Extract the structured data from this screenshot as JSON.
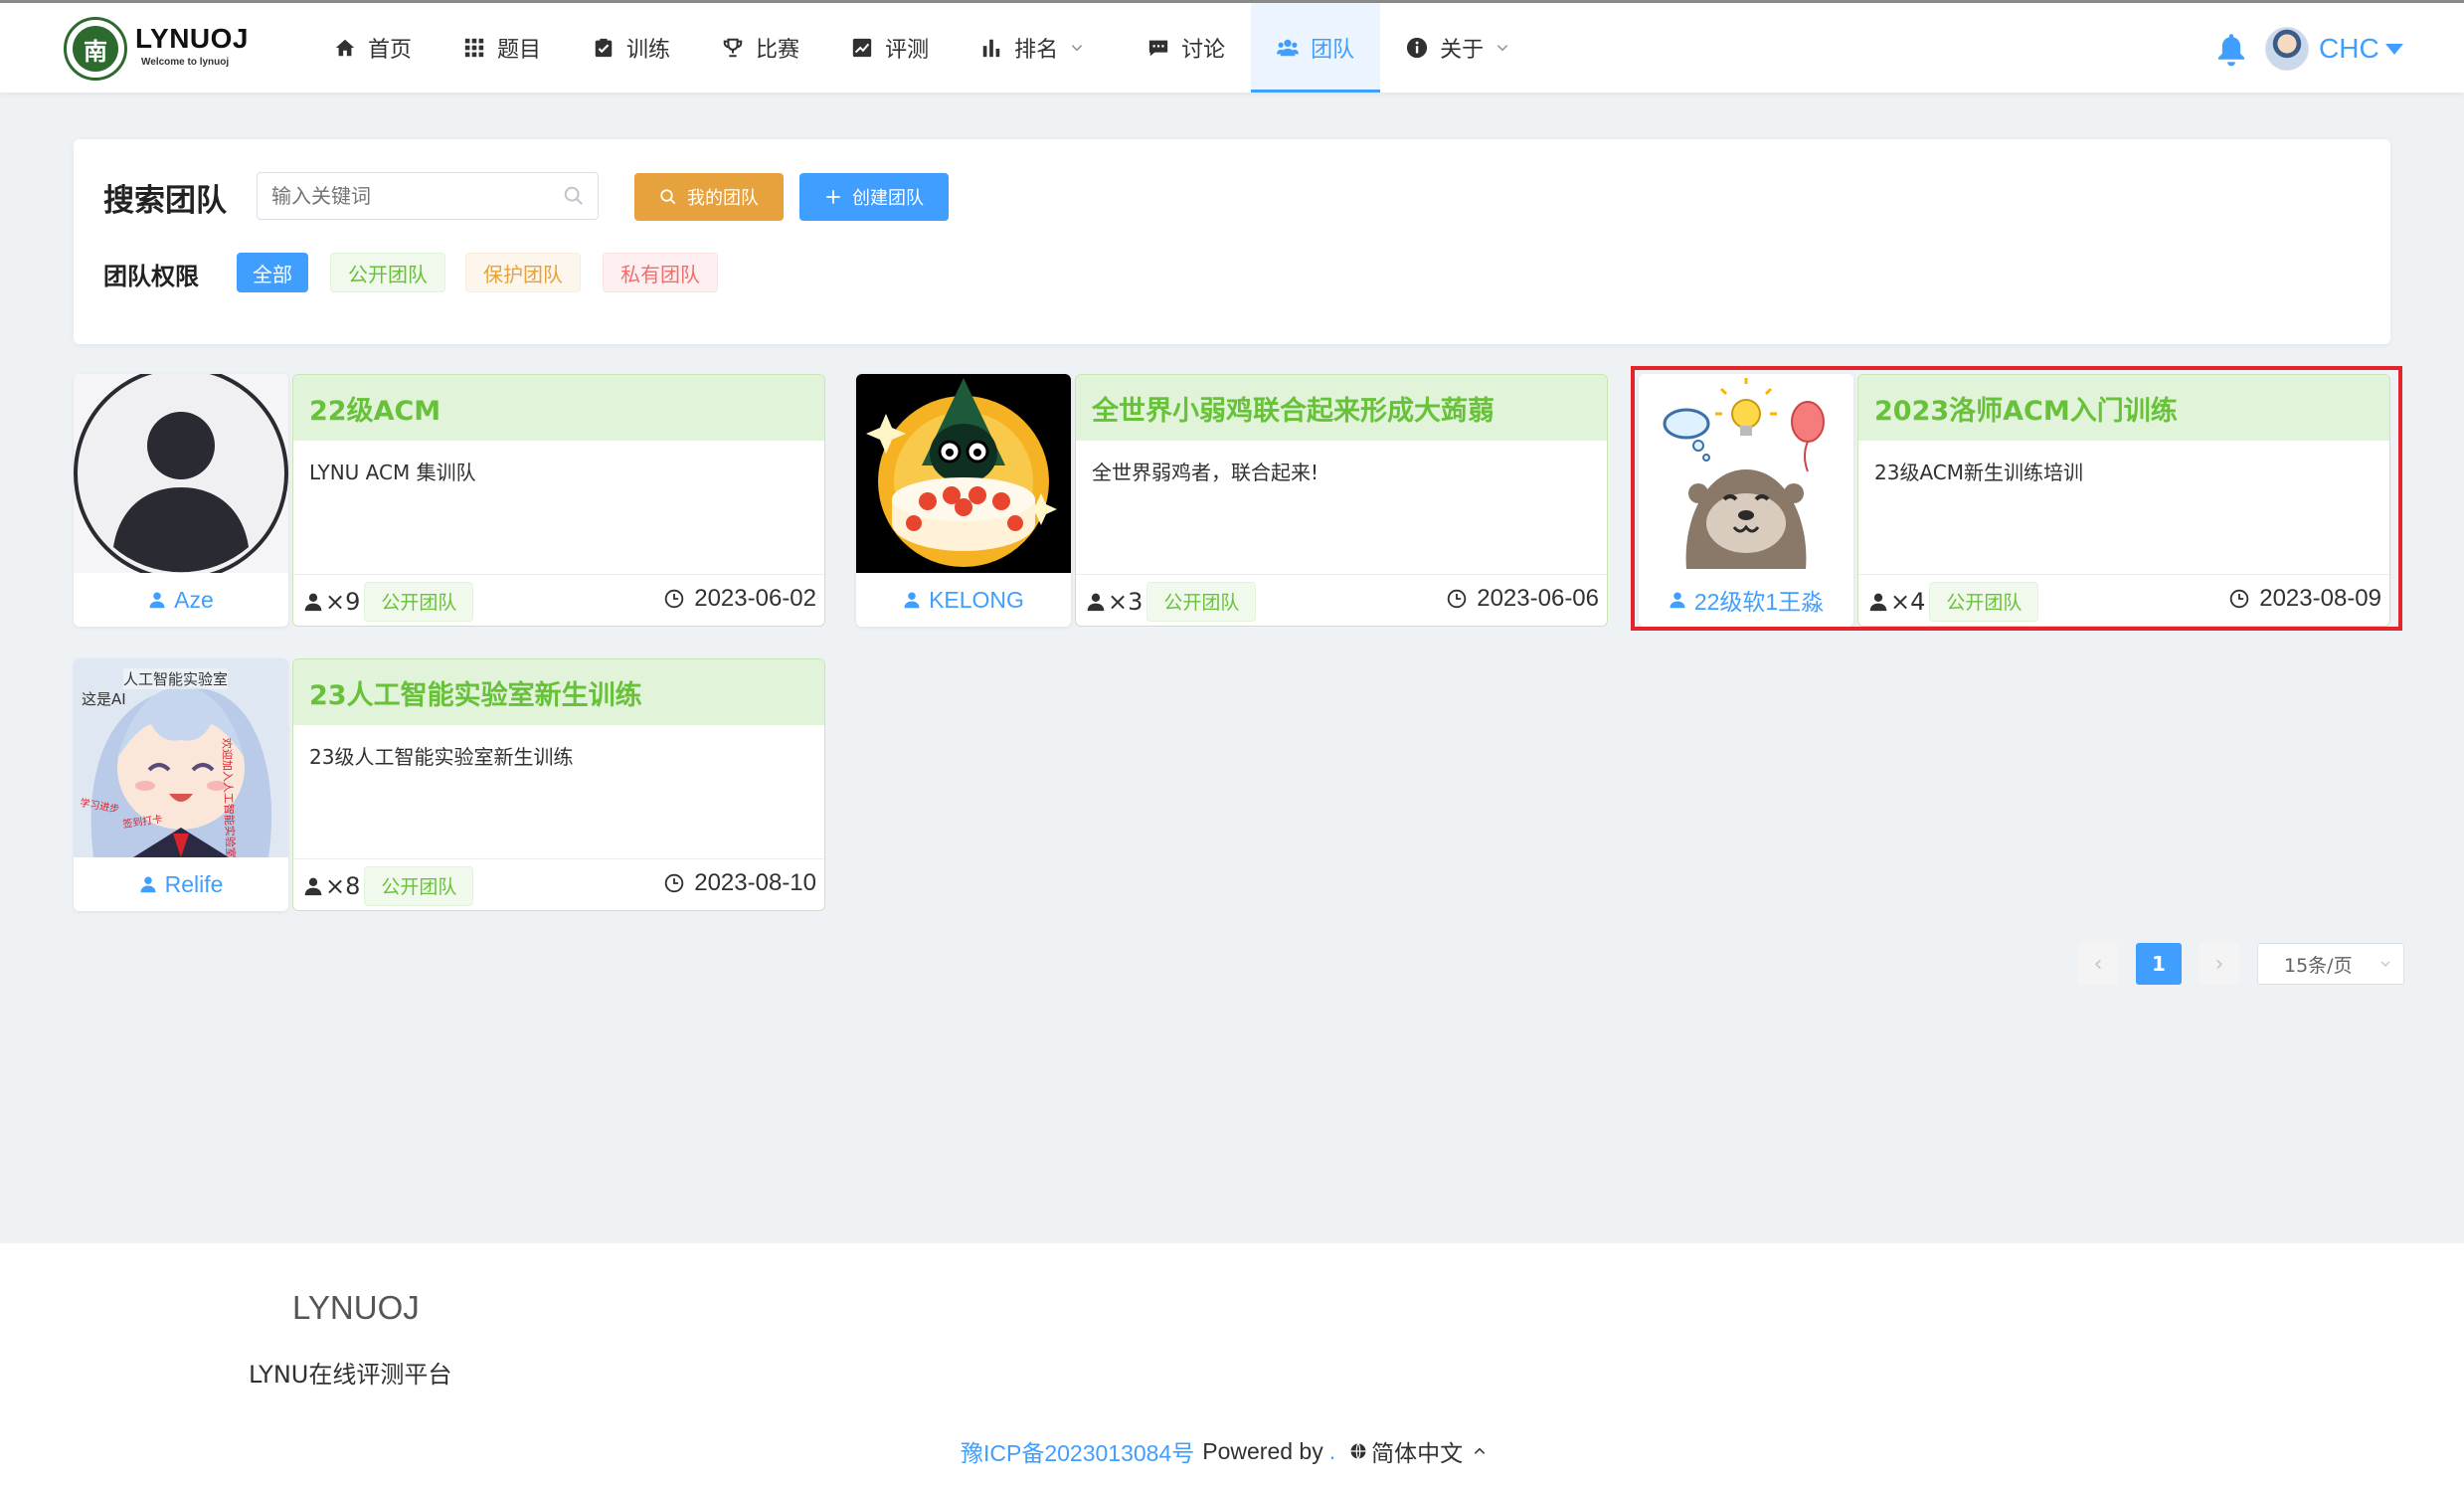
{
  "app": {
    "brand": "LYNUOJ",
    "brand_sub": "Welcome to lynuoj",
    "logo_glyph": "南",
    "accent": "#409eff",
    "success": "#67c23a",
    "warning": "#e6a23c",
    "danger": "#f56c6c"
  },
  "nav": {
    "items": [
      {
        "label": "首页",
        "icon": "home-icon"
      },
      {
        "label": "题目",
        "icon": "grid-icon"
      },
      {
        "label": "训练",
        "icon": "clipboard-check-icon"
      },
      {
        "label": "比赛",
        "icon": "trophy-icon"
      },
      {
        "label": "评测",
        "icon": "trend-chart-icon"
      },
      {
        "label": "排名",
        "icon": "bar-chart-icon",
        "dropdown": true
      },
      {
        "label": "讨论",
        "icon": "comment-icon"
      },
      {
        "label": "团队",
        "icon": "users-icon",
        "active": true
      },
      {
        "label": "关于",
        "icon": "info-icon",
        "dropdown": true
      }
    ],
    "username": "CHC"
  },
  "search": {
    "title": "搜索团队",
    "placeholder": "输入关键词",
    "my_team_label": "我的团队",
    "create_team_label": "创建团队",
    "permission_label": "团队权限",
    "filters": [
      "全部",
      "公开团队",
      "保护团队",
      "私有团队"
    ]
  },
  "teams": [
    {
      "name": "22级ACM",
      "desc": "LYNU ACM 集训队",
      "owner": "Aze",
      "members": "×9",
      "privacy": "公开团队",
      "date": "2023-06-02"
    },
    {
      "name": "全世界小弱鸡联合起来形成大蒟蒻",
      "desc": "全世界弱鸡者，联合起来!",
      "owner": "KELONG",
      "members": "×3",
      "privacy": "公开团队",
      "date": "2023-06-06"
    },
    {
      "name": "2023洛师ACM入门训练",
      "desc": "23级ACM新生训练培训",
      "owner": "22级软1王淼",
      "members": "×4",
      "privacy": "公开团队",
      "date": "2023-08-09"
    },
    {
      "name": "23人工智能实验室新生训练",
      "desc": "23级人工智能实验室新生训练",
      "owner": "Relife",
      "members": "×8",
      "privacy": "公开团队",
      "date": "2023-08-10"
    }
  ],
  "avatar_texts": {
    "anime_title": "人工智能实验室",
    "anime_note": "这是AI"
  },
  "pagination": {
    "prev": "‹",
    "current": "1",
    "next": "›",
    "page_size": "15条/页"
  },
  "footer": {
    "title": "LYNUOJ",
    "subtitle": "LYNU在线评测平台",
    "icp": "豫ICP备2023013084号",
    "powered": "Powered by",
    "dot": ".",
    "language": "简体中文"
  }
}
